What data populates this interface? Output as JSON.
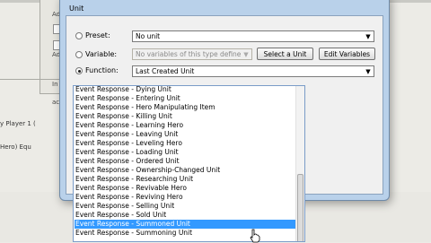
{
  "background": {
    "left_labels": [
      "Ad",
      "Ad",
      "In",
      "ac"
    ],
    "trigger_lines": [
      "y Player 1 (",
      "Hero) Equ"
    ]
  },
  "dialog": {
    "title": "Unit",
    "preset": {
      "label": "Preset:",
      "value": "No unit"
    },
    "variable": {
      "label": "Variable:",
      "value": "No variables of this type define",
      "select_button": "Select a Unit",
      "edit_button": "Edit Variables"
    },
    "function": {
      "label": "Function:",
      "value": "Last Created Unit"
    },
    "list": {
      "items": [
        "Event Response - Dying Unit",
        "Event Response - Entering Unit",
        "Event Response - Hero Manipulating Item",
        "Event Response - Killing Unit",
        "Event Response - Learning Hero",
        "Event Response - Leaving Unit",
        "Event Response - Leveling Hero",
        "Event Response - Loading Unit",
        "Event Response - Ordered Unit",
        "Event Response - Ownership-Changed Unit",
        "Event Response - Researching Unit",
        "Event Response - Revivable Hero",
        "Event Response - Reviving Hero",
        "Event Response - Selling Unit",
        "Event Response - Sold Unit",
        "Event Response - Summoned Unit",
        "Event Response - Summoning Unit"
      ],
      "selected_index": 15
    }
  }
}
